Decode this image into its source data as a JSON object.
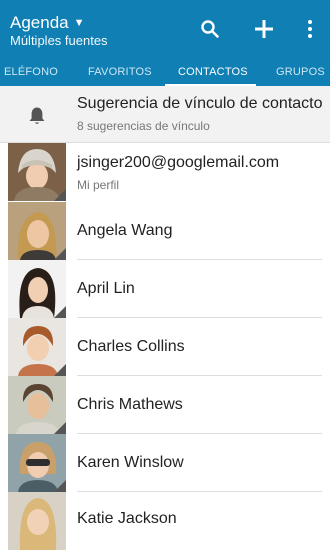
{
  "header": {
    "title": "Agenda",
    "subtitle": "Múltiples fuentes",
    "actions": {
      "search_icon": "search-icon",
      "add_icon": "plus-icon",
      "menu_icon": "more-vert-icon"
    }
  },
  "tabs": [
    {
      "label": "ELÉFONO",
      "active": false
    },
    {
      "label": "FAVORITOS",
      "active": false
    },
    {
      "label": "CONTACTOS",
      "active": true
    },
    {
      "label": "GRUPOS",
      "active": false
    }
  ],
  "suggestion": {
    "icon": "bell-icon",
    "title": "Sugerencia de vínculo de contacto",
    "subtitle": "8 sugerencias de vínculo"
  },
  "contacts": [
    {
      "name": "jsinger200@googlemail.com",
      "subtitle": "Mi perfil"
    },
    {
      "name": "Angela Wang"
    },
    {
      "name": "April Lin"
    },
    {
      "name": "Charles Collins"
    },
    {
      "name": "Chris Mathews"
    },
    {
      "name": "Karen Winslow"
    },
    {
      "name": "Katie Jackson"
    }
  ],
  "colors": {
    "header_bg": "#0f7fb4",
    "tab_inactive": "#cfe7f3",
    "suggestion_bg": "#f2f2f2"
  }
}
